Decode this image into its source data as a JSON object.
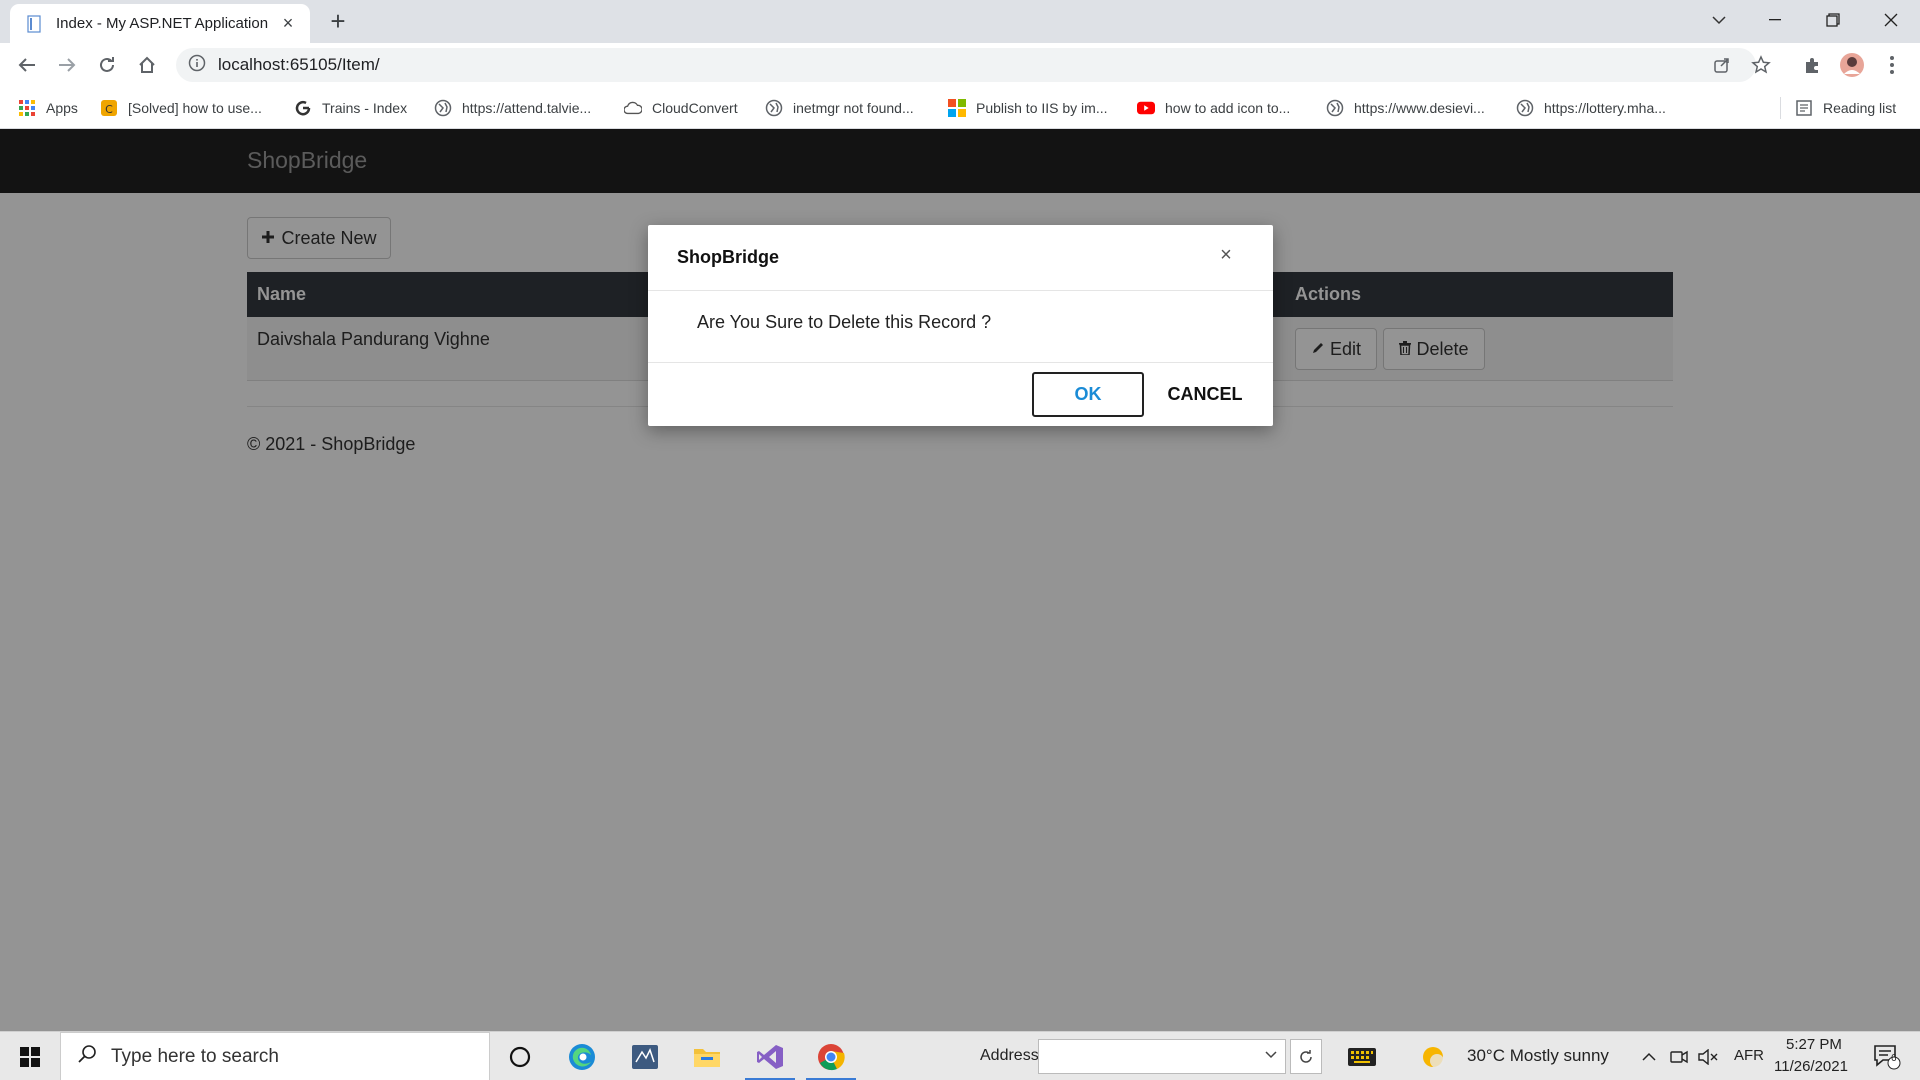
{
  "browser": {
    "tab_title": "Index - My ASP.NET Application",
    "tab_close": "×",
    "new_tab": "+",
    "url": "localhost:65105/Item/",
    "bookmarks": [
      {
        "label": "Apps",
        "icon": "apps-grid-icon"
      },
      {
        "label": "[Solved] how to use...",
        "icon": "forum-icon"
      },
      {
        "label": "Trains - Index",
        "icon": "trains-icon"
      },
      {
        "label": "https://attend.talvie...",
        "icon": "globe-icon"
      },
      {
        "label": "CloudConvert",
        "icon": "cloud-icon"
      },
      {
        "label": "inetmgr not found...",
        "icon": "globe-icon"
      },
      {
        "label": "Publish to IIS by im...",
        "icon": "microsoft-icon"
      },
      {
        "label": "how to add icon to...",
        "icon": "youtube-icon"
      },
      {
        "label": "https://www.desievi...",
        "icon": "globe-icon"
      },
      {
        "label": "https://lottery.mha...",
        "icon": "globe-icon"
      }
    ],
    "reading_list": "Reading list"
  },
  "app": {
    "brand": "ShopBridge",
    "create_new": "Create New",
    "table": {
      "headers": [
        "Name",
        "Actions"
      ],
      "rows": [
        {
          "name": "Daivshala Pandurang Vighne",
          "edit": "Edit",
          "delete": "Delete"
        }
      ]
    },
    "footer": "© 2021 - ShopBridge"
  },
  "modal": {
    "title": "ShopBridge",
    "close": "×",
    "message": "Are You Sure to Delete this Record ?",
    "ok": "OK",
    "cancel": "CANCEL"
  },
  "taskbar": {
    "search_placeholder": "Type here to search",
    "address_label": "Address",
    "weather": "30°C  Mostly sunny",
    "language": "AFR",
    "time": "5:27 PM",
    "date": "11/26/2021",
    "notifications": "6"
  },
  "colors": {
    "navbar": "#222222",
    "table_header": "#343a40",
    "ok_text": "#1a8bd6"
  }
}
